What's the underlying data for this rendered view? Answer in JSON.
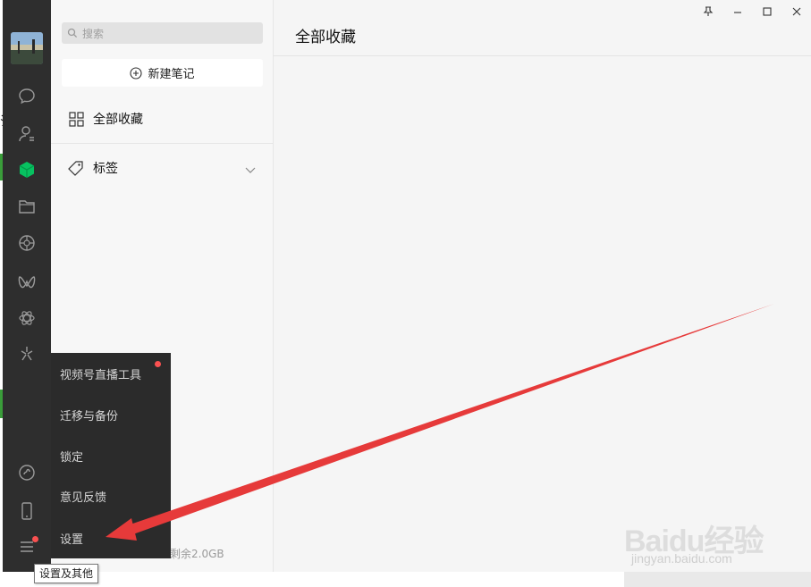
{
  "sidebar": {
    "avatar": "avatar",
    "icons": [
      "chat-icon",
      "contacts-icon",
      "favorites-cube-icon",
      "folder-icon",
      "moments-aperture-icon",
      "channels-icon",
      "mini-program-icon",
      "search-discover-icon",
      "mini-programs-link-icon",
      "phone-icon",
      "menu-icon"
    ],
    "active_color": "#07c160"
  },
  "middle": {
    "search_placeholder": "搜索",
    "new_note_label": "新建笔记",
    "all_favorites_label": "全部收藏",
    "tags_label": "标签",
    "storage_text": "剩余2.0GB"
  },
  "main": {
    "title": "全部收藏"
  },
  "window_controls": [
    "pin-icon",
    "minimize-icon",
    "maximize-icon",
    "close-icon"
  ],
  "menu": {
    "items": [
      {
        "label": "视频号直播工具",
        "has_dot": true
      },
      {
        "label": "迁移与备份"
      },
      {
        "label": "锁定"
      },
      {
        "label": "意见反馈"
      },
      {
        "label": "设置"
      }
    ]
  },
  "tooltip": {
    "text": "设置及其他"
  },
  "watermark": {
    "brand": "Baidu经验",
    "url": "jingyan.baidu.com"
  },
  "annotation": {
    "arrow_color": "#e63a3a"
  }
}
